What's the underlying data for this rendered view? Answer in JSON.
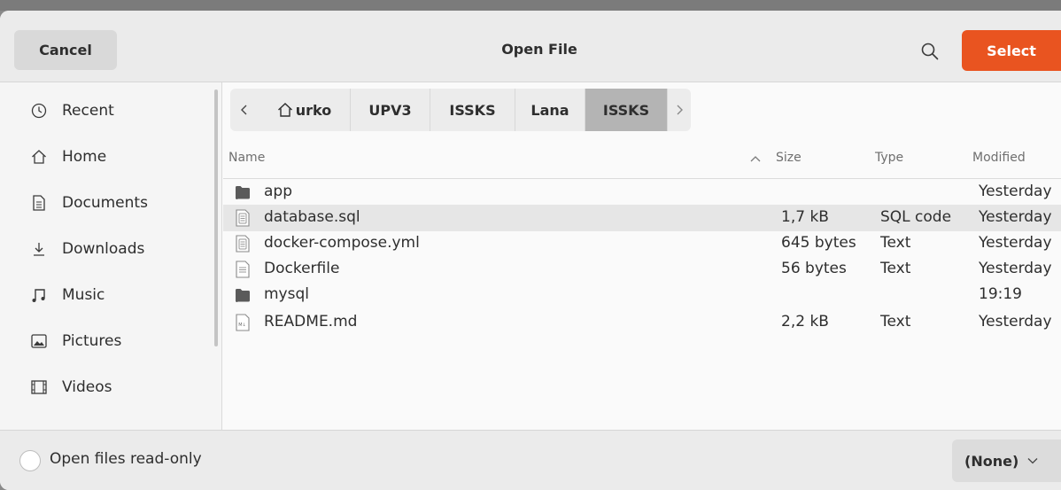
{
  "header": {
    "cancel_label": "Cancel",
    "title": "Open File",
    "select_label": "Select",
    "accent_color": "#e95420",
    "search_icon": "search-icon"
  },
  "sidebar": {
    "items": [
      {
        "label": "Recent",
        "icon": "clock-icon"
      },
      {
        "label": "Home",
        "icon": "home-icon"
      },
      {
        "label": "Documents",
        "icon": "document-icon"
      },
      {
        "label": "Downloads",
        "icon": "download-icon"
      },
      {
        "label": "Music",
        "icon": "music-icon"
      },
      {
        "label": "Pictures",
        "icon": "picture-icon"
      },
      {
        "label": "Videos",
        "icon": "video-icon"
      }
    ]
  },
  "breadcrumb": {
    "items": [
      "urko",
      "UPV3",
      "ISSKS",
      "Lana",
      "ISSKS"
    ],
    "active": "ISSKS"
  },
  "list": {
    "columns": {
      "name": "Name",
      "size": "Size",
      "type": "Type",
      "modified": "Modified"
    },
    "rows": [
      {
        "name": "app",
        "size": "",
        "type": "",
        "modified": "Yesterday",
        "kind": "folder"
      },
      {
        "name": "database.sql",
        "size": "1,7 kB",
        "type": "SQL code",
        "modified": "Yesterday",
        "kind": "file",
        "selected": true
      },
      {
        "name": "docker-compose.yml",
        "size": "645 bytes",
        "type": "Text",
        "modified": "Yesterday",
        "kind": "file"
      },
      {
        "name": "Dockerfile",
        "size": "56 bytes",
        "type": "Text",
        "modified": "Yesterday",
        "kind": "file"
      },
      {
        "name": "mysql",
        "size": "",
        "type": "",
        "modified": "19:19",
        "kind": "folder"
      },
      {
        "name": "README.md",
        "size": "2,2 kB",
        "type": "Text",
        "modified": "Yesterday",
        "kind": "markdown"
      }
    ]
  },
  "footer": {
    "readonly_label": "Open files read-only",
    "filter_value": "(None)"
  }
}
